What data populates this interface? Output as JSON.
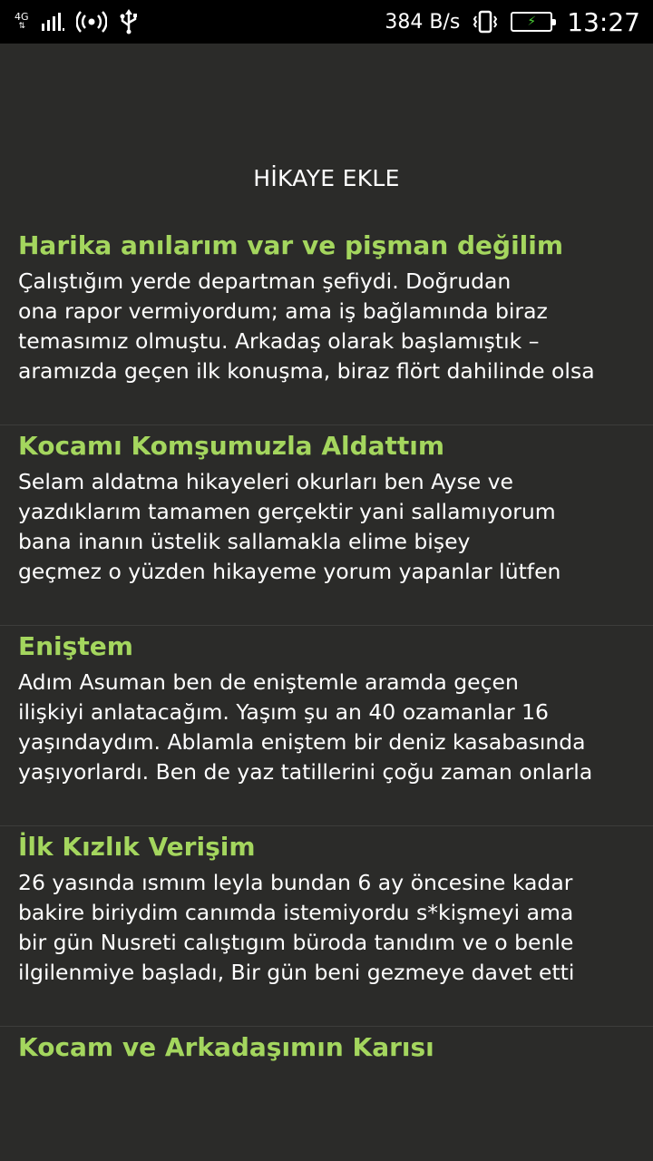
{
  "status_bar": {
    "network_type": "4G",
    "speed": "384 B/s",
    "time": "13:27"
  },
  "header": {
    "title": "HİKAYE EKLE"
  },
  "stories": [
    {
      "title": "Harika anılarım var ve pişman değilim",
      "excerpt": "Çalıştığım yerde departman şefiydi. Doğrudan\nona rapor vermiyordum; ama iş bağlamında biraz\ntemasımız olmuştu. Arkadaş olarak başlamıştık –\naramızda geçen ilk konuşma, biraz flört dahilinde olsa"
    },
    {
      "title": "Kocamı Komşumuzla Aldattım",
      "excerpt": "Selam aldatma hikayeleri okurları ben Ayse ve\nyazdıklarım tamamen gerçektir yani sallamıyorum\nbana inanın üstelik sallamakla elime bişey\ngeçmez o yüzden hikayeme yorum yapanlar lütfen"
    },
    {
      "title": "Eniştem",
      "excerpt": "Adım Asuman ben de eniştemle aramda geçen\nilişkiyi anlatacağım. Yaşım şu an 40 ozamanlar 16\nyaşındaydım. Ablamla eniştem bir deniz kasabasında\nyaşıyorlardı. Ben de yaz tatillerini çoğu zaman onlarla"
    },
    {
      "title": "İlk Kızlık Verişim",
      "excerpt": "26 yasında ısmım leyla bundan 6 ay öncesine kadar\nbakire biriydim canımda istemiyordu s*kişmeyi ama\nbir gün Nusreti calıştıgım büroda tanıdım ve o benle\nilgilenmiye başladı,  Bir gün beni gezmeye davet etti"
    },
    {
      "title": "Kocam ve Arkadaşımın Karısı",
      "excerpt": ""
    }
  ]
}
